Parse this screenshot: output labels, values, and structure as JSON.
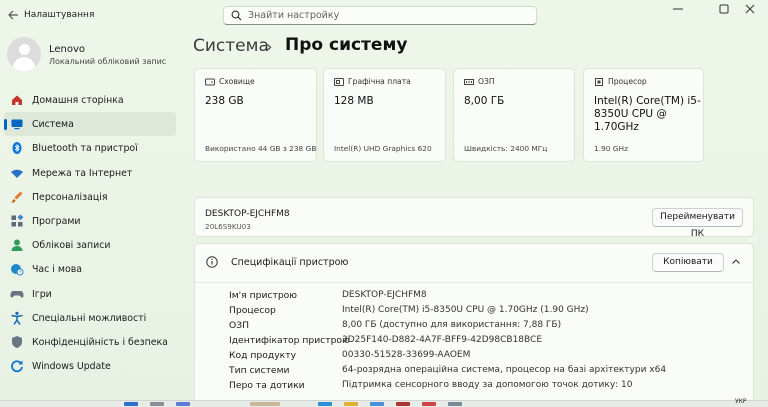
{
  "window": {
    "title": "Налаштування"
  },
  "search": {
    "placeholder": "Знайти настройку"
  },
  "profile": {
    "name": "Lenovo",
    "account": "Локальний обліковий запис"
  },
  "nav": [
    {
      "label": "Домашня сторінка",
      "icon": "home-icon",
      "color": "#c0392b"
    },
    {
      "label": "Система",
      "icon": "system-icon",
      "color": "#0067c0",
      "selected": true
    },
    {
      "label": "Bluetooth та пристрої",
      "icon": "bluetooth-icon",
      "color": "#0a74d4"
    },
    {
      "label": "Мережа та Інтернет",
      "icon": "wifi-icon",
      "color": "#2b6fc9"
    },
    {
      "label": "Персоналізація",
      "icon": "brush-icon",
      "color": "#e07a2e"
    },
    {
      "label": "Програми",
      "icon": "apps-icon",
      "color": "#5a6b7a"
    },
    {
      "label": "Облікові записи",
      "icon": "person-icon",
      "color": "#2e9b5f"
    },
    {
      "label": "Час і мова",
      "icon": "globe-clock-icon",
      "color": "#1f8ac9"
    },
    {
      "label": "Ігри",
      "icon": "gamepad-icon",
      "color": "#6a7480"
    },
    {
      "label": "Спеціальні можливості",
      "icon": "accessibility-icon",
      "color": "#1466b8"
    },
    {
      "label": "Конфіденційність і безпека",
      "icon": "shield-icon",
      "color": "#6b7683"
    },
    {
      "label": "Windows Update",
      "icon": "update-icon",
      "color": "#0a74d4"
    }
  ],
  "breadcrumb": {
    "parent": "Система",
    "separator": "›",
    "current": "Про систему"
  },
  "cards": [
    {
      "title": "Сховище",
      "icon": "storage-icon",
      "value": "238 GB",
      "sub": "Використано 44 GB з 238 GB"
    },
    {
      "title": "Графічна плата",
      "icon": "gpu-icon",
      "value": "128 MB",
      "sub": "Intel(R) UHD Graphics 620"
    },
    {
      "title": "ОЗП",
      "icon": "ram-icon",
      "value": "8,00 ГБ",
      "sub": "Швидкість: 2400 МГц"
    },
    {
      "title": "Процесор",
      "icon": "cpu-icon",
      "value": "Intel(R) Core(TM) i5-8350U CPU @ 1.70GHz",
      "sub": "1.90 GHz"
    }
  ],
  "device": {
    "name": "DESKTOP-EJCHFM8",
    "model": "20L6S9KU03",
    "rename_label": "Перейменувати ПК"
  },
  "specs": {
    "title": "Специфікації пристрою",
    "copy_label": "Копіювати",
    "rows": [
      {
        "key": "Ім'я пристрою",
        "value": "DESKTOP-EJCHFM8"
      },
      {
        "key": "Процесор",
        "value": "Intel(R) Core(TM) i5-8350U CPU @ 1.70GHz (1.90 GHz)"
      },
      {
        "key": "ОЗП",
        "value": "8,00 ГБ (доступно для використання: 7,88 ГБ)"
      },
      {
        "key": "Ідентифікатор пристрою",
        "value": "3D25F140-D882-4A7F-BFF9-42D98CB18BCE"
      },
      {
        "key": "Код продукту",
        "value": "00330-51528-33699-AAOEM"
      },
      {
        "key": "Тип системи",
        "value": "64-розрядна операційна система, процесор на базі архітектури x64"
      },
      {
        "key": "Перо та дотики",
        "value": "Підтримка сенсорного вводу за допомогою точок дотику: 10"
      }
    ]
  },
  "taskbar": {
    "lang": "УКР"
  },
  "colors": {
    "accent": "#0067c0",
    "background": "#e9f3e6"
  }
}
